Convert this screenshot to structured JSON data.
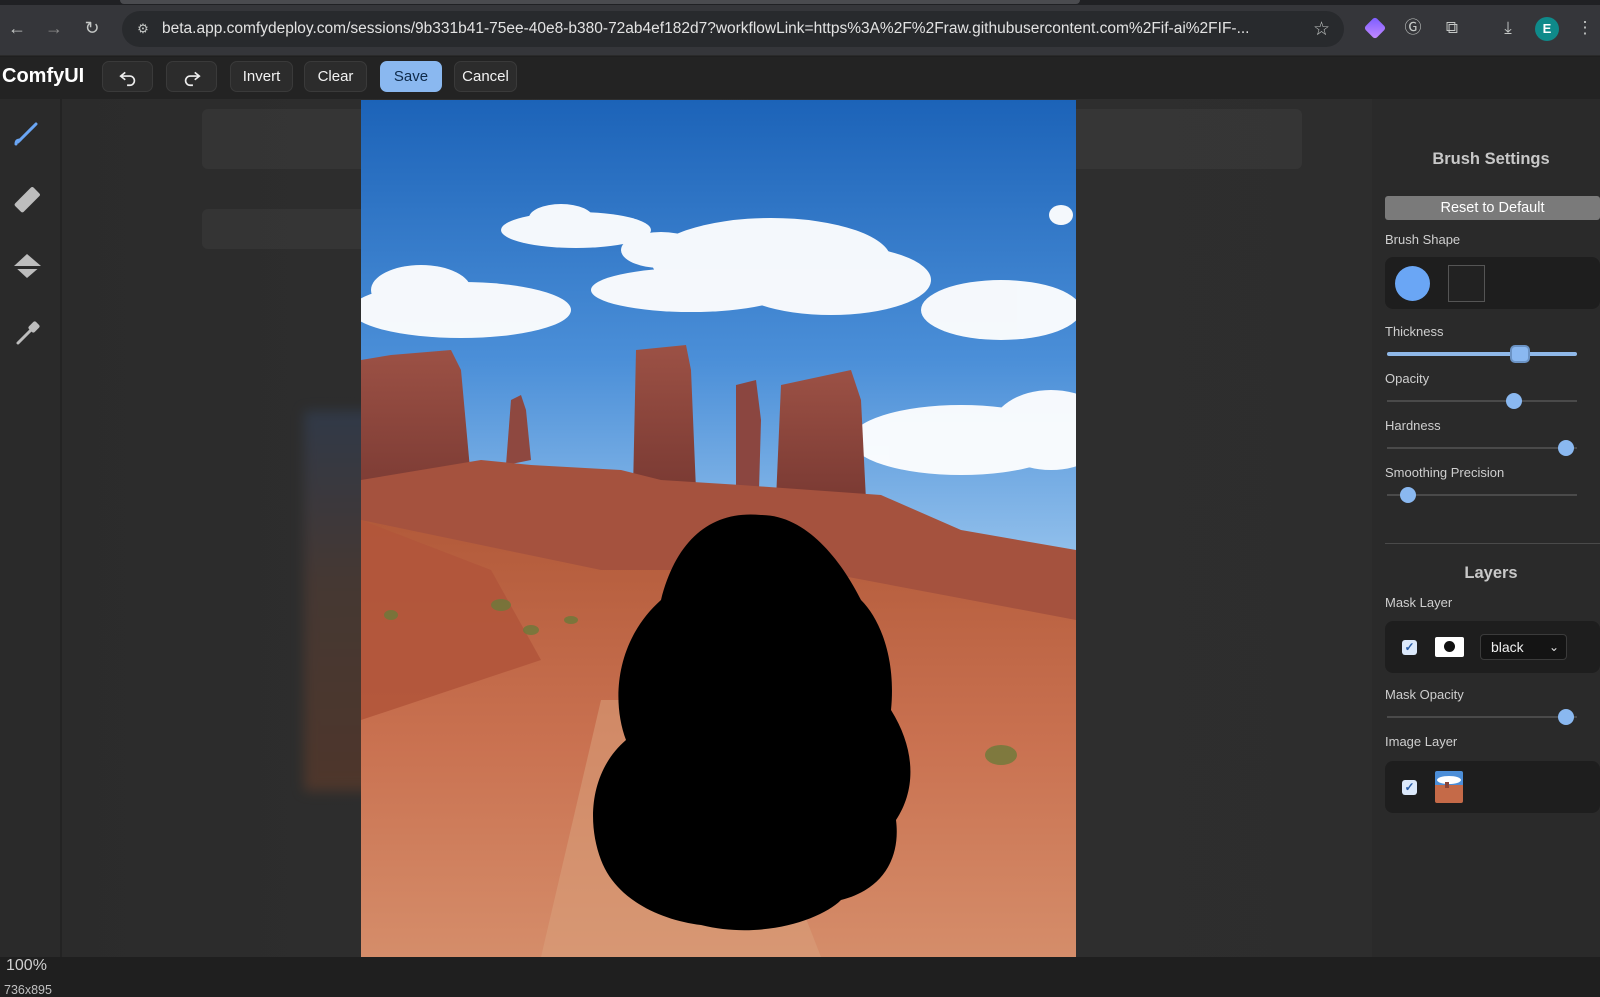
{
  "browser": {
    "url": "beta.app.comfydeploy.com/sessions/9b331b41-75ee-40e8-b380-72ab4ef182d7?workflowLink=https%3A%2F%2Fraw.githubusercontent.com%2Fif-ai%2FIF-...",
    "avatar_letter": "E"
  },
  "toolbar": {
    "logo": "ComfyUI",
    "invert_label": "Invert",
    "clear_label": "Clear",
    "save_label": "Save",
    "cancel_label": "Cancel"
  },
  "tools": [
    "brush-icon",
    "eraser-icon",
    "paint-bucket-icon",
    "color-picker-icon"
  ],
  "status": {
    "zoom": "100%",
    "dimensions": "736x895"
  },
  "brush_settings": {
    "title": "Brush Settings",
    "reset_label": "Reset to Default",
    "shape_label": "Brush Shape",
    "thickness_label": "Thickness",
    "thickness_value": 0.7,
    "opacity_label": "Opacity",
    "opacity_value": 0.67,
    "hardness_label": "Hardness",
    "hardness_value": 0.94,
    "smoothing_label": "Smoothing Precision",
    "smoothing_value": 0.11
  },
  "layers": {
    "title": "Layers",
    "mask_layer_label": "Mask Layer",
    "mask_color": "black",
    "mask_opacity_label": "Mask Opacity",
    "mask_opacity_value": 0.94,
    "image_layer_label": "Image Layer"
  },
  "colors": {
    "accent": "#8ab8f0",
    "panel_bg": "#2a2a2a",
    "app_bg": "#232323"
  }
}
